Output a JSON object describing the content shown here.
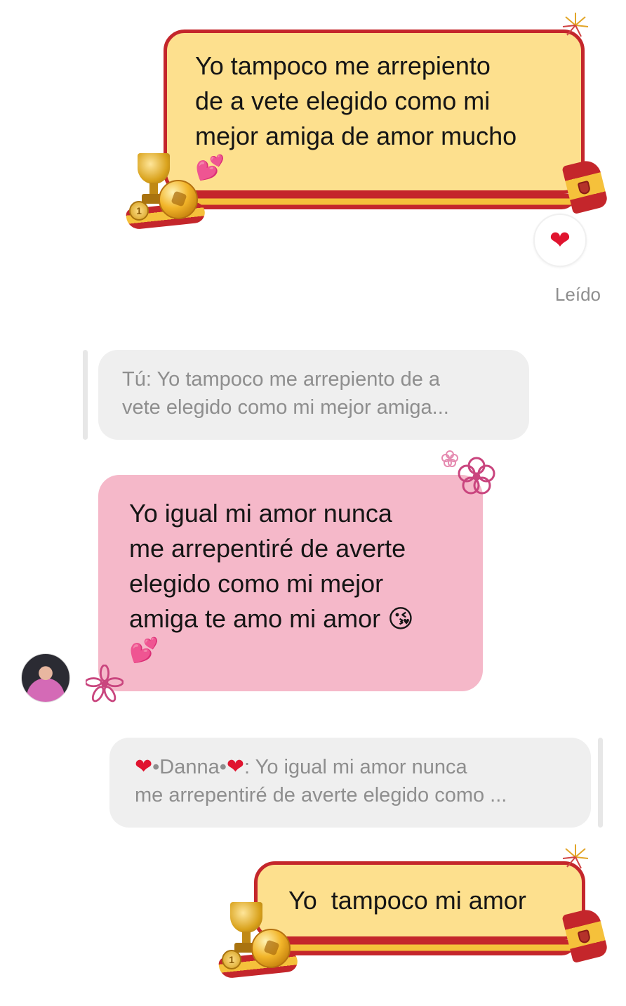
{
  "conversation": {
    "messages": [
      {
        "id": "sent-1",
        "sender": "me",
        "lines": [
          "Yo tampoco me arrepiento",
          "de a vete elegido como mi",
          "mejor amiga de amor mucho"
        ],
        "trailing_emoji": "💕",
        "reaction": "❤"
      },
      {
        "id": "received-1",
        "sender": "Danna",
        "reply_preview": {
          "prefix": "Tú:",
          "lines": [
            "Yo tampoco me arrepiento de a",
            "vete elegido como mi mejor amiga..."
          ]
        },
        "lines": [
          "Yo igual mi amor nunca",
          "me arrepentiré de averte",
          "elegido como mi mejor",
          "amiga te amo mi amor"
        ],
        "inline_emoji": "😘",
        "trailing_emoji": "💕"
      },
      {
        "id": "sent-2",
        "sender": "me",
        "reply_preview": {
          "heart": "❤",
          "name": "•Danna•",
          "suffix": ":",
          "line1_rest": "Yo igual mi amor nunca",
          "line2": "me arrepentiré de averte elegido como ..."
        },
        "text": "Yo  tampoco mi amor"
      }
    ],
    "read_status": "Leído"
  },
  "icons": {
    "trophy": "trophy-icon",
    "soccer_ball": "soccer-ball-icon",
    "flag": "spain-flag-icon",
    "firework": "firework-icon",
    "flower": "flower-icon",
    "avatar": "danna-avatar"
  },
  "colors": {
    "sent_bubble": "#fde08e",
    "sent_border": "#c4262b",
    "received_bubble": "#f5b8c9",
    "quote_bg": "#efefef",
    "reaction_heart": "#e0142f",
    "muted_text": "#8e8e8e"
  },
  "coin_label": "1"
}
